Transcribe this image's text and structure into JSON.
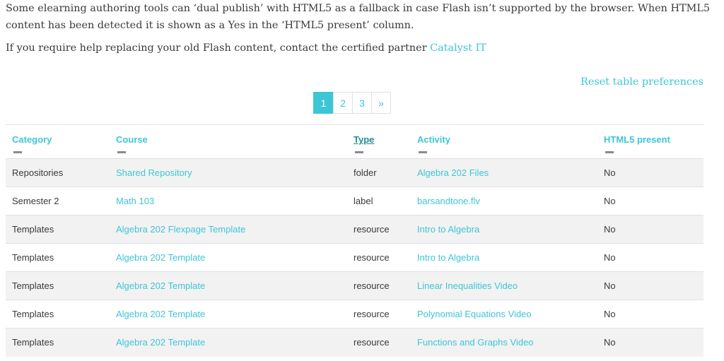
{
  "intro": {
    "line1": "Some elearning authoring tools can ‘dual publish’ with HTML5 as a fallback in case Flash isn’t supported by the browser. When HTML5 content has been detected it is shown as a Yes in the ‘HTML5 present’ column.",
    "help_prefix": "If you require help replacing your old Flash content, contact the certified partner ",
    "help_link": "Catalyst IT"
  },
  "reset_label": "Reset table preferences",
  "pagination": {
    "pages": [
      "1",
      "2",
      "3"
    ],
    "next": "»",
    "active": "1"
  },
  "table": {
    "headers": {
      "category": "Category",
      "course": "Course",
      "type": "Type",
      "activity": "Activity",
      "html5": "HTML5 present"
    },
    "rows": [
      {
        "category": "Repositories",
        "course": "Shared Repository",
        "type": "folder",
        "activity": "Algebra 202 Files",
        "html5": "No"
      },
      {
        "category": "Semester 2",
        "course": "Math 103",
        "type": "label",
        "activity": "barsandtone.flv",
        "html5": "No"
      },
      {
        "category": "Templates",
        "course": "Algebra 202 Flexpage Template",
        "type": "resource",
        "activity": "Intro to Algebra",
        "html5": "No"
      },
      {
        "category": "Templates",
        "course": "Algebra 202 Template",
        "type": "resource",
        "activity": "Intro to Algebra",
        "html5": "No"
      },
      {
        "category": "Templates",
        "course": "Algebra 202 Template",
        "type": "resource",
        "activity": "Linear Inequalities Video",
        "html5": "No"
      },
      {
        "category": "Templates",
        "course": "Algebra 202 Template",
        "type": "resource",
        "activity": "Polynomial Equations Video",
        "html5": "No"
      },
      {
        "category": "Templates",
        "course": "Algebra 202 Template",
        "type": "resource",
        "activity": "Functions and Graphs Video",
        "html5": "No"
      }
    ]
  },
  "colors": {
    "accent": "#3dc6d6",
    "text": "#373a3c",
    "stripe": "#f2f2f2"
  }
}
